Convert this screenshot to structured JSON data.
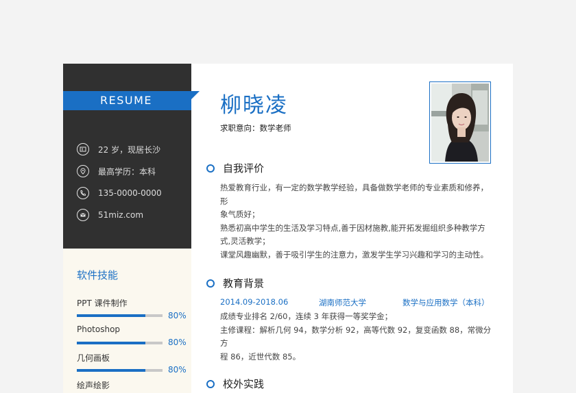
{
  "sidebar": {
    "resume_label": "RESUME",
    "info": [
      {
        "icon": "id-card-icon",
        "text": "22 岁，现居长沙"
      },
      {
        "icon": "location-icon",
        "text": "最高学历：本科"
      },
      {
        "icon": "phone-icon",
        "text": "135-0000-0000"
      },
      {
        "icon": "mail-icon",
        "text": "51miz.com"
      }
    ],
    "skills_title": "软件技能",
    "skills": [
      {
        "name": "PPT 课件制作",
        "percent": 80,
        "label": "80%"
      },
      {
        "name": "Photoshop",
        "percent": 80,
        "label": "80%"
      },
      {
        "name": "几何画板",
        "percent": 80,
        "label": "80%"
      },
      {
        "name": "绘声绘影"
      }
    ]
  },
  "main": {
    "name": "柳晓凌",
    "intent": "求职意向：数学老师",
    "sections": [
      {
        "title": "自我评价"
      },
      {
        "title": "教育背景"
      },
      {
        "title": "校外实践"
      }
    ],
    "self_eval": [
      "热爱教育行业，有一定的数学教学经验，具备做数学老师的专业素质和修养，形",
      "象气质好；",
      "熟悉初高中学生的生活及学习特点,善于因材施教,能开拓发掘组织多种教学方",
      "式,灵活教学；",
      "课堂风趣幽默，善于吸引学生的注意力，激发学生学习兴趣和学习的主动性。"
    ],
    "education": {
      "period": "2014.09-2018.06",
      "school": "湖南师范大学",
      "major": "数学与应用数学（本科）",
      "lines": [
        "成绩专业排名 2/60，连续 3 年获得一等奖学金；",
        "主修课程：解析几何 94，数学分析 92，高等代数 92，复变函数 88，常微分方",
        "程 86，近世代数 85。"
      ]
    }
  },
  "colors": {
    "accent": "#1a6fc4",
    "sidebar_dark": "#303030",
    "sidebar_light": "#fbf8ef"
  }
}
